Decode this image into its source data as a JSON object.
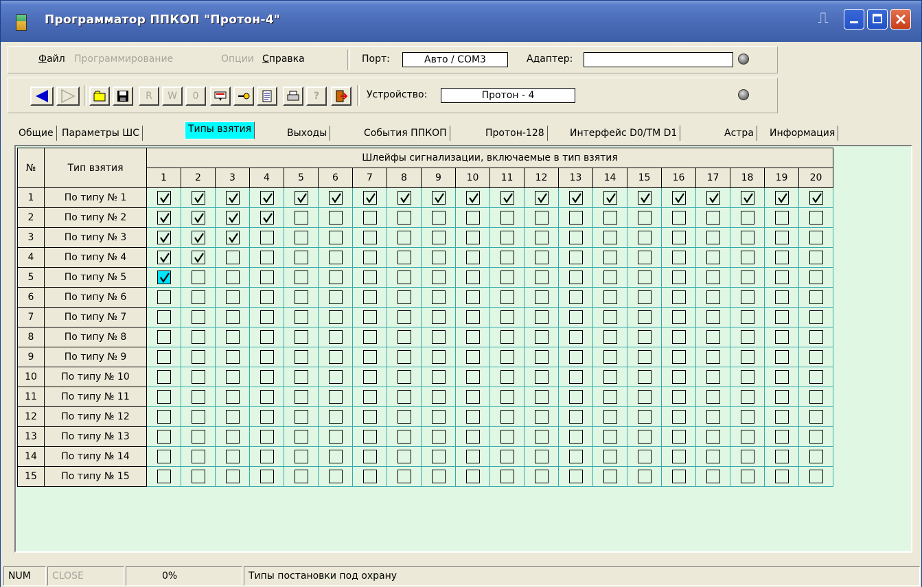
{
  "window": {
    "title": "Программатор ППКОП \"Протон-4\""
  },
  "menu": {
    "file": "Файл",
    "file_accel": "Ф",
    "programming": "Программирование",
    "options": "Опции",
    "help": "Справка",
    "help_accel": "С"
  },
  "port": {
    "label": "Порт:",
    "value": "Авто / COM3"
  },
  "adapter": {
    "label": "Адаптер:",
    "value": ""
  },
  "device": {
    "label": "Устройство:",
    "value": "Протон - 4"
  },
  "toolbar": {
    "buttons": [
      "back-arrow",
      "forward-arrow",
      "folder-open",
      "save-disk",
      "read-device",
      "write-device",
      "verify-device",
      "keyboard",
      "key",
      "document",
      "printer",
      "help",
      "exit"
    ]
  },
  "tabs": [
    "Общие",
    "Параметры ШС",
    "Типы взятия",
    "Выходы",
    "События ППКОП",
    "Протон-128",
    "Интерфейс D0/TM D1",
    "Астра",
    "Информация"
  ],
  "active_tab": 2,
  "table": {
    "col_num": "№",
    "col_type": "Тип взятия",
    "group_header": "Шлейфы сигнализации, включаемые в тип взятия",
    "loop_numbers": [
      "1",
      "2",
      "3",
      "4",
      "5",
      "6",
      "7",
      "8",
      "9",
      "10",
      "11",
      "12",
      "13",
      "14",
      "15",
      "16",
      "17",
      "18",
      "19",
      "20"
    ],
    "rows": [
      {
        "num": "1",
        "name": "По типу № 1",
        "checked": 20
      },
      {
        "num": "2",
        "name": "По типу № 2",
        "checked": 4
      },
      {
        "num": "3",
        "name": "По типу № 3",
        "checked": 3
      },
      {
        "num": "4",
        "name": "По типу № 4",
        "checked": 2
      },
      {
        "num": "5",
        "name": "По типу № 5",
        "checked": 1
      },
      {
        "num": "6",
        "name": "По типу № 6",
        "checked": 0
      },
      {
        "num": "7",
        "name": "По типу № 7",
        "checked": 0
      },
      {
        "num": "8",
        "name": "По типу № 8",
        "checked": 0
      },
      {
        "num": "9",
        "name": "По типу № 9",
        "checked": 0
      },
      {
        "num": "10",
        "name": "По типу № 10",
        "checked": 0
      },
      {
        "num": "11",
        "name": "По типу № 11",
        "checked": 0
      },
      {
        "num": "12",
        "name": "По типу № 12",
        "checked": 0
      },
      {
        "num": "13",
        "name": "По типу № 13",
        "checked": 0
      },
      {
        "num": "14",
        "name": "По типу № 14",
        "checked": 0
      },
      {
        "num": "15",
        "name": "По типу № 15",
        "checked": 0
      }
    ],
    "selected_cell": {
      "row": 4,
      "col": 0
    }
  },
  "status": {
    "num": "NUM",
    "close": "CLOSE",
    "progress": "0%",
    "message": "Типы постановки под охрану"
  },
  "colors": {
    "title_bar": "#4b6cb8",
    "active_tab": "#00ffff",
    "grid_bg": "#e0f7e4",
    "grid_lines": "#33aaaa",
    "selected_cell": "#00e5ff"
  }
}
